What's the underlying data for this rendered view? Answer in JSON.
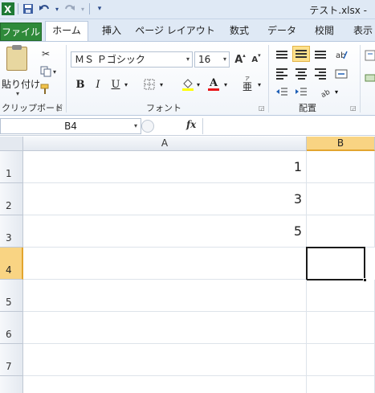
{
  "window": {
    "title": "テスト.xlsx  -"
  },
  "qat": {
    "excel_icon": "excel-app-icon",
    "save_icon": "save-icon",
    "undo_icon": "undo-icon",
    "redo_icon": "redo-icon",
    "customize_icon": "customize-qat-icon"
  },
  "tabs": [
    {
      "label": "ファイル"
    },
    {
      "label": "ホーム"
    },
    {
      "label": "挿入"
    },
    {
      "label": "ページ レイアウト"
    },
    {
      "label": "数式"
    },
    {
      "label": "データ"
    },
    {
      "label": "校閲"
    },
    {
      "label": "表示"
    }
  ],
  "ribbon": {
    "clipboard": {
      "paste_label": "貼り付け",
      "group_label": "クリップボード"
    },
    "font": {
      "font_name": "ＭＳ Ｐゴシック",
      "font_size": "16",
      "grow_label": "A",
      "shrink_label": "A",
      "bold_label": "B",
      "italic_label": "I",
      "underline_label": "U",
      "font_color_label": "A",
      "phonetic_label": "亜",
      "group_label": "フォント"
    },
    "alignment": {
      "group_label": "配置"
    }
  },
  "formula_bar": {
    "name_box": "B4",
    "fx_label": "fx",
    "formula": ""
  },
  "sheet": {
    "columns": [
      {
        "label": "A",
        "selected": false
      },
      {
        "label": "B",
        "selected": true
      }
    ],
    "rows": [
      {
        "label": "1",
        "a": "1",
        "selected": false
      },
      {
        "label": "2",
        "a": "3",
        "selected": false
      },
      {
        "label": "3",
        "a": "5",
        "selected": false
      },
      {
        "label": "4",
        "a": "",
        "selected": true
      },
      {
        "label": "5",
        "a": "",
        "selected": false
      },
      {
        "label": "6",
        "a": "",
        "selected": false
      },
      {
        "label": "7",
        "a": "",
        "selected": false
      }
    ],
    "active_cell": "B4"
  },
  "colors": {
    "file_tab": "#2f8a3a",
    "selected_header": "#f9d483",
    "active_cell_border": "#1a1a1a"
  }
}
